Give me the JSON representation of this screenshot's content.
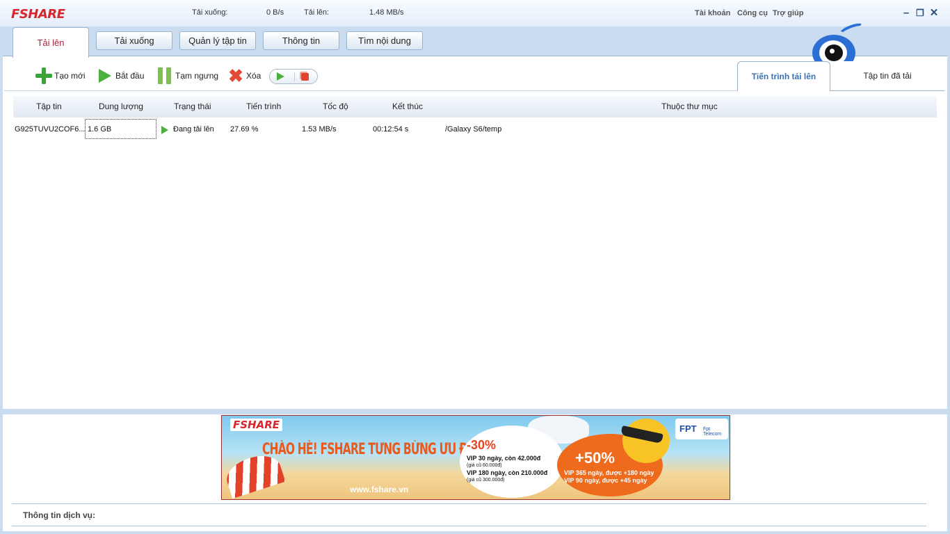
{
  "app": {
    "logo": "FSHARE",
    "stats": {
      "download_label": "Tải xuống:",
      "download_speed": "0 B/s",
      "upload_label": "Tải lên:",
      "upload_speed": "1.48 MB/s"
    },
    "menu": [
      "Tài khoản",
      "Công cụ",
      "Trợ giúp"
    ],
    "window_buttons": [
      "minimize-icon",
      "restore-icon",
      "close-icon"
    ]
  },
  "main_tabs": [
    "Tải lên",
    "Tải xuống",
    "Quản lý tập tin",
    "Thông tin",
    "Tìm nội dung"
  ],
  "toolbar": {
    "new_label": "Tạo mới",
    "start_label": "Bắt đầu",
    "pause_label": "Tạm ngưng",
    "delete_label": "Xóa"
  },
  "right_tabs": [
    "Tiến trình tải lên",
    "Tập tin đã tải"
  ],
  "table": {
    "columns": [
      "Tập tin",
      "Dung lượng",
      "Trạng thái",
      "Tiến trình",
      "Tốc độ",
      "Kết thúc",
      "Thuộc thư mục"
    ],
    "rows": [
      {
        "file": "G925TUVU2COF6...",
        "size": "1.6 GB",
        "status": "Đang tải lên",
        "progress": "27.69 %",
        "speed": "1.53 MB/s",
        "eta": "00:12:54 s",
        "folder": "/Galaxy S6/temp"
      }
    ]
  },
  "banner": {
    "logo": "FSHARE",
    "headline": "CHÀO HÈ! FSHARE TƯNG BỪNG ƯU ĐÃI",
    "url": "www.fshare.vn",
    "offer1": {
      "discount": "-30%",
      "line1": "VIP 30 ngày, còn 42.000đ",
      "line1_old": "(giá cũ 60.000đ)",
      "line2": "VIP 180 ngày, còn 210.000đ",
      "line2_old": "(giá cũ 300.000đ)"
    },
    "offer2": {
      "bonus": "+50%",
      "line1": "VIP 365 ngày, được +180 ngày",
      "line2": "VIP 90 ngày, được +45 ngày"
    },
    "partner": {
      "name": "FPT",
      "sub": "Fpt Telecom"
    }
  },
  "service": {
    "label": "Thông tin dịch vụ:"
  }
}
